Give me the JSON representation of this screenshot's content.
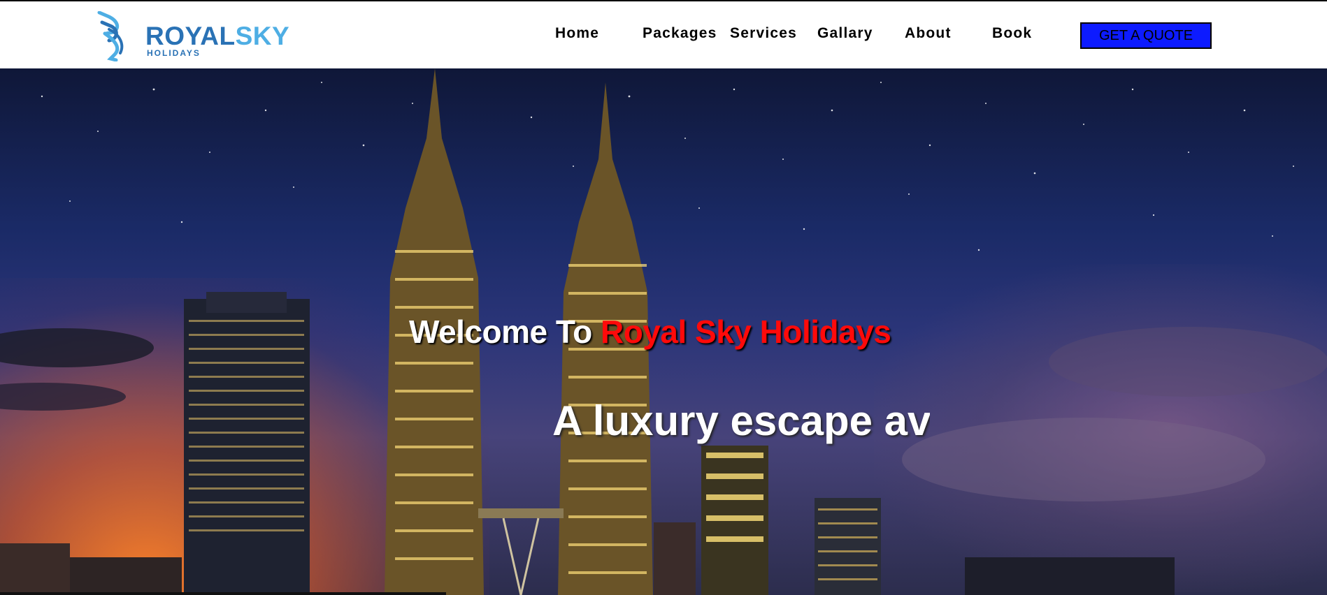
{
  "brand": {
    "name_part1": "ROYAL",
    "name_part2": "SKY",
    "sub": "HOLIDAYS"
  },
  "nav": {
    "items": [
      {
        "label": "Home"
      },
      {
        "label": "Packages"
      },
      {
        "label": "Services"
      },
      {
        "label": "Gallary"
      },
      {
        "label": "About"
      },
      {
        "label": "Book"
      }
    ],
    "cta_label": "GET A QUOTE"
  },
  "hero": {
    "welcome_prefix": "Welcome To ",
    "welcome_brand": "Royal Sky Holidays",
    "tagline": "A luxury escape av"
  },
  "colors": {
    "brand_dark": "#2a72b5",
    "brand_light": "#4eaee4",
    "cta_bg": "#0d1bff",
    "highlight_red": "#ff0a0a"
  }
}
